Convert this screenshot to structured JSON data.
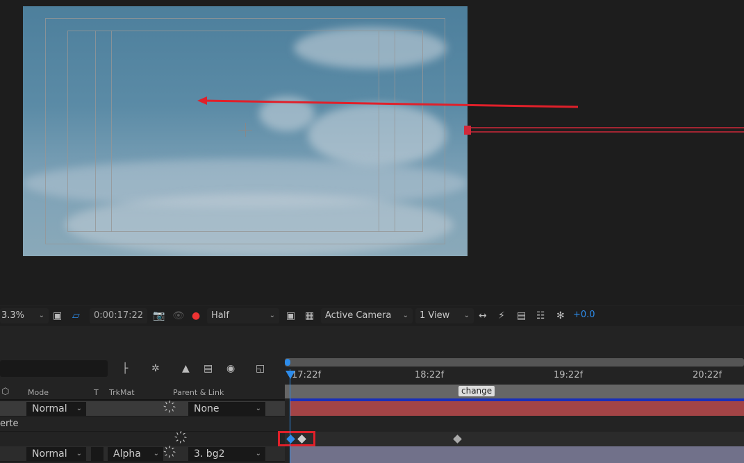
{
  "toolbar": {
    "zoom": "3.3%",
    "timecode": "0:00:17:22",
    "resolution": "Half",
    "camera": "Active Camera",
    "views": "1 View",
    "exposure": "+0.0"
  },
  "timeline": {
    "columns": {
      "mode": "Mode",
      "t": "T",
      "trkmat": "TrkMat",
      "parent": "Parent & Link"
    },
    "ruler": {
      "current": "17:22f",
      "ticks": [
        "18:22f",
        "19:22f",
        "20:22f"
      ]
    },
    "marker": "change",
    "rows": [
      {
        "mode": "Normal",
        "parent": "None"
      },
      {
        "label": "erte"
      },
      {},
      {
        "mode": "Normal",
        "trkmat": "Alpha",
        "parent": "3. bg2"
      }
    ]
  },
  "colors": {
    "accent": "#2d8ceb",
    "annotation": "#e0202a",
    "layer_red": "#a34446",
    "layer_gray": "#71718a"
  }
}
